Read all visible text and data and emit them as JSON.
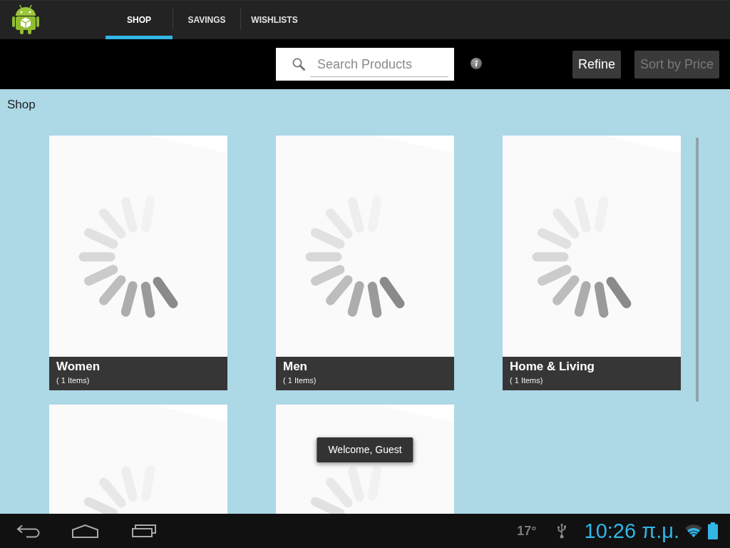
{
  "action_bar": {
    "tabs": [
      {
        "label": "SHOP",
        "selected": true
      },
      {
        "label": "SAVINGS",
        "selected": false
      },
      {
        "label": "WISHLISTS",
        "selected": false
      }
    ]
  },
  "toolbar": {
    "search": {
      "placeholder": "Search Products"
    },
    "buttons": [
      {
        "label": "Refine",
        "disabled": false
      },
      {
        "label": "Sort by Price",
        "disabled": true
      }
    ]
  },
  "content": {
    "heading": "Shop",
    "cards": [
      {
        "kind": "captioned",
        "title": "Women",
        "count": "( 1 Items)"
      },
      {
        "kind": "captioned",
        "title": "Men",
        "count": "( 1 Items)"
      },
      {
        "kind": "captioned",
        "title": "Home & Living",
        "count": "( 1 Items)"
      },
      {
        "kind": "image_only"
      },
      {
        "kind": "image_only"
      }
    ]
  },
  "toast": {
    "message": "Welcome, Guest"
  },
  "navigation_bar": {
    "temperature": "17°",
    "time": "10:26 π.μ."
  }
}
